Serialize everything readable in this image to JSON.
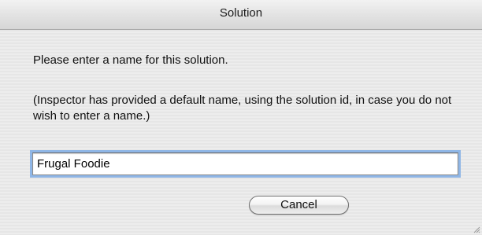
{
  "window": {
    "title": "Solution"
  },
  "dialog": {
    "message": "Please enter a name for this solution.",
    "note": "(Inspector has provided a default name, using the solution id, in case you do not wish to enter a name.)",
    "name_value": "Frugal Foodie",
    "cancel_label": "Cancel"
  }
}
